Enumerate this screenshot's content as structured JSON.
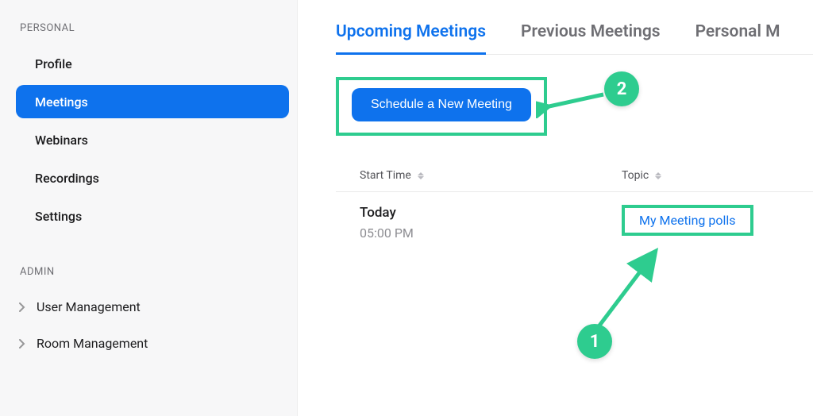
{
  "sidebar": {
    "personal_label": "PERSONAL",
    "items": [
      {
        "label": "Profile"
      },
      {
        "label": "Meetings"
      },
      {
        "label": "Webinars"
      },
      {
        "label": "Recordings"
      },
      {
        "label": "Settings"
      }
    ],
    "admin_label": "ADMIN",
    "admin_items": [
      {
        "label": "User Management"
      },
      {
        "label": "Room Management"
      }
    ]
  },
  "tabs": {
    "upcoming": "Upcoming Meetings",
    "previous": "Previous Meetings",
    "personal": "Personal M"
  },
  "actions": {
    "schedule": "Schedule a New Meeting"
  },
  "table": {
    "header_start": "Start Time",
    "header_topic": "Topic",
    "row": {
      "day": "Today",
      "time": "05:00 PM",
      "topic": "My Meeting polls"
    }
  },
  "annotations": {
    "step1": "1",
    "step2": "2"
  },
  "colors": {
    "accent": "#0E72ED",
    "annotation": "#2ECC8F"
  }
}
